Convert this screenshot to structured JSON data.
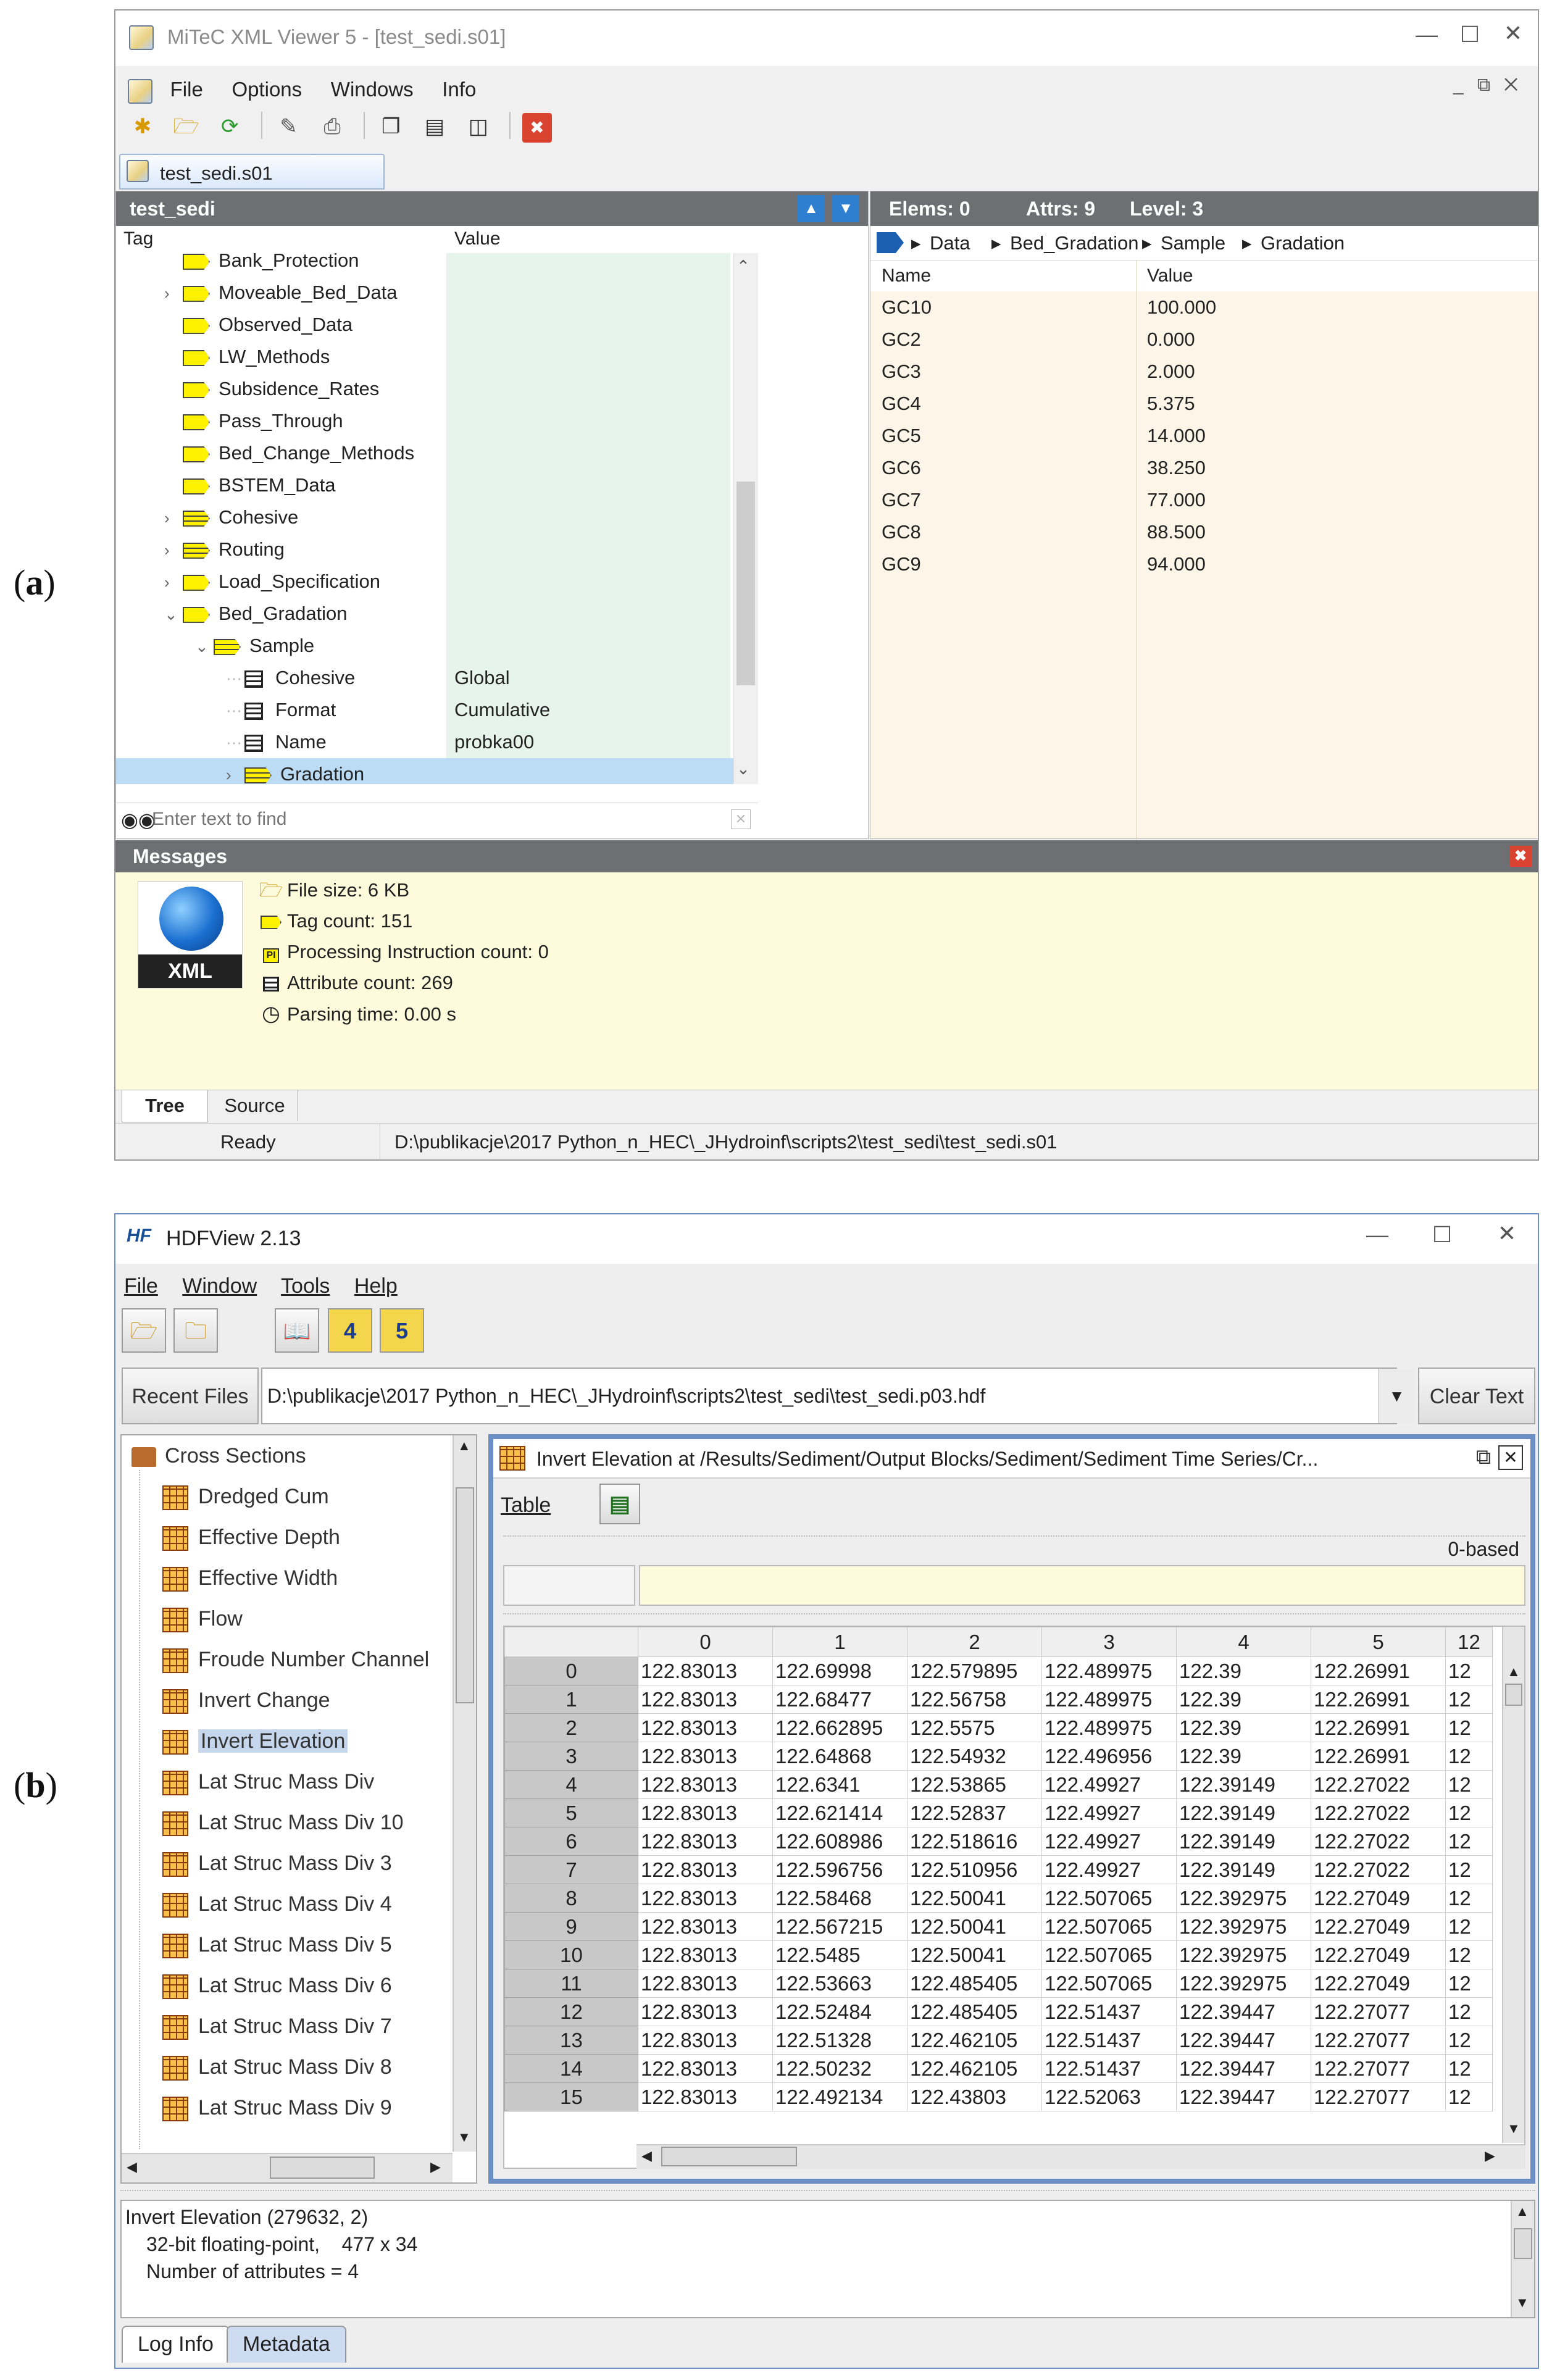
{
  "labels": {
    "a": "a",
    "b": "b"
  },
  "win_a": {
    "title": "MiTeC XML Viewer 5 - [test_sedi.s01]",
    "menu": [
      "File",
      "Options",
      "Windows",
      "Info"
    ],
    "doc_tab": "test_sedi.s01",
    "tree_header": "test_sedi",
    "col_tag": "Tag",
    "col_value": "Value",
    "tree_rows": [
      {
        "label": "Bank_Protection",
        "value": "",
        "expand": ""
      },
      {
        "label": "Moveable_Bed_Data",
        "value": "",
        "expand": ">"
      },
      {
        "label": "Observed_Data",
        "value": "",
        "expand": ""
      },
      {
        "label": "LW_Methods",
        "value": "",
        "expand": ""
      },
      {
        "label": "Subsidence_Rates",
        "value": "",
        "expand": ""
      },
      {
        "label": "Pass_Through",
        "value": "",
        "expand": ""
      },
      {
        "label": "Bed_Change_Methods",
        "value": "",
        "expand": ""
      },
      {
        "label": "BSTEM_Data",
        "value": "",
        "expand": ""
      },
      {
        "label": "Cohesive",
        "value": "",
        "expand": ">"
      },
      {
        "label": "Routing",
        "value": "",
        "expand": ">"
      },
      {
        "label": "Load_Specification",
        "value": "",
        "expand": ">"
      },
      {
        "label": "Bed_Gradation",
        "value": "",
        "expand": "v"
      },
      {
        "label": "Sample",
        "value": "",
        "expand": "v"
      },
      {
        "label": "Cohesive",
        "value": "Global",
        "expand": ""
      },
      {
        "label": "Format",
        "value": "Cumulative",
        "expand": ""
      },
      {
        "label": "Name",
        "value": "probka00",
        "expand": ""
      },
      {
        "label": "Gradation",
        "value": "",
        "expand": ">"
      }
    ],
    "find_placeholder": "Enter text to find",
    "stats": {
      "elems": "Elems: 0",
      "attrs": "Attrs: 9",
      "level": "Level: 3"
    },
    "breadcrumb": [
      "Data",
      "Bed_Gradation",
      "Sample",
      "Gradation"
    ],
    "list_col_name": "Name",
    "list_col_value": "Value",
    "attributes": [
      {
        "name": "GC10",
        "value": "100.000"
      },
      {
        "name": "GC2",
        "value": "0.000"
      },
      {
        "name": "GC3",
        "value": "2.000"
      },
      {
        "name": "GC4",
        "value": "5.375"
      },
      {
        "name": "GC5",
        "value": "14.000"
      },
      {
        "name": "GC6",
        "value": "38.250"
      },
      {
        "name": "GC7",
        "value": "77.000"
      },
      {
        "name": "GC8",
        "value": "88.500"
      },
      {
        "name": "GC9",
        "value": "94.000"
      }
    ],
    "messages_title": "Messages",
    "xml_badge": "XML",
    "messages": [
      "File size: 6 KB",
      "Tag count: 151",
      "Processing Instruction count: 0",
      "Attribute count: 269",
      "Parsing time: 0.00 s"
    ],
    "pi_badge": "PI",
    "tabs": [
      "Tree",
      "Source"
    ],
    "status_left": "Ready",
    "status_path": "D:\\publikacje\\2017 Python_n_HEC\\_JHydroinf\\scripts2\\test_sedi\\test_sedi.s01"
  },
  "win_b": {
    "title": "HDFView 2.13",
    "logo": "HF",
    "menu": [
      "File",
      "Window",
      "Tools",
      "Help"
    ],
    "recent_files": "Recent Files",
    "path": "D:\\publikacje\\2017 Python_n_HEC\\_JHydroinf\\scripts2\\test_sedi\\test_sedi.p03.hdf",
    "clear_text": "Clear Text",
    "tree_root": "Cross Sections",
    "tree_items": [
      "Dredged Cum",
      "Effective Depth",
      "Effective Width",
      "Flow",
      "Froude Number Channel",
      "Invert Change",
      "Invert Elevation",
      "Lat Struc Mass Div",
      "Lat Struc Mass Div 10",
      "Lat Struc Mass Div 3",
      "Lat Struc Mass Div 4",
      "Lat Struc Mass Div 5",
      "Lat Struc Mass Div 6",
      "Lat Struc Mass Div 7",
      "Lat Struc Mass Div 8",
      "Lat Struc Mass Div 9"
    ],
    "selected_index": 6,
    "dataset_title": "Invert Elevation  at  /Results/Sediment/Output Blocks/Sediment/Sediment Time Series/Cr...",
    "table_menu": "Table",
    "index_base": "0-based",
    "columns": [
      "0",
      "1",
      "2",
      "3",
      "4",
      "5",
      "12"
    ],
    "rows": [
      [
        "0",
        "122.83013",
        "122.69998",
        "122.579895",
        "122.489975",
        "122.39",
        "122.26991",
        "12"
      ],
      [
        "1",
        "122.83013",
        "122.68477",
        "122.56758",
        "122.489975",
        "122.39",
        "122.26991",
        "12"
      ],
      [
        "2",
        "122.83013",
        "122.662895",
        "122.5575",
        "122.489975",
        "122.39",
        "122.26991",
        "12"
      ],
      [
        "3",
        "122.83013",
        "122.64868",
        "122.54932",
        "122.496956",
        "122.39",
        "122.26991",
        "12"
      ],
      [
        "4",
        "122.83013",
        "122.6341",
        "122.53865",
        "122.49927",
        "122.39149",
        "122.27022",
        "12"
      ],
      [
        "5",
        "122.83013",
        "122.621414",
        "122.52837",
        "122.49927",
        "122.39149",
        "122.27022",
        "12"
      ],
      [
        "6",
        "122.83013",
        "122.608986",
        "122.518616",
        "122.49927",
        "122.39149",
        "122.27022",
        "12"
      ],
      [
        "7",
        "122.83013",
        "122.596756",
        "122.510956",
        "122.49927",
        "122.39149",
        "122.27022",
        "12"
      ],
      [
        "8",
        "122.83013",
        "122.58468",
        "122.50041",
        "122.507065",
        "122.392975",
        "122.27049",
        "12"
      ],
      [
        "9",
        "122.83013",
        "122.567215",
        "122.50041",
        "122.507065",
        "122.392975",
        "122.27049",
        "12"
      ],
      [
        "10",
        "122.83013",
        "122.5485",
        "122.50041",
        "122.507065",
        "122.392975",
        "122.27049",
        "12"
      ],
      [
        "11",
        "122.83013",
        "122.53663",
        "122.485405",
        "122.507065",
        "122.392975",
        "122.27049",
        "12"
      ],
      [
        "12",
        "122.83013",
        "122.52484",
        "122.485405",
        "122.51437",
        "122.39447",
        "122.27077",
        "12"
      ],
      [
        "13",
        "122.83013",
        "122.51328",
        "122.462105",
        "122.51437",
        "122.39447",
        "122.27077",
        "12"
      ],
      [
        "14",
        "122.83013",
        "122.50232",
        "122.462105",
        "122.51437",
        "122.39447",
        "122.27077",
        "12"
      ],
      [
        "15",
        "122.83013",
        "122.492134",
        "122.43803",
        "122.52063",
        "122.39447",
        "122.27077",
        "12"
      ]
    ],
    "info_lines": [
      "Invert Elevation (279632, 2)",
      "32-bit floating-point,    477 x 34",
      "Number of attributes = 4"
    ],
    "bottom_tabs": [
      "Log Info",
      "Metadata"
    ]
  }
}
